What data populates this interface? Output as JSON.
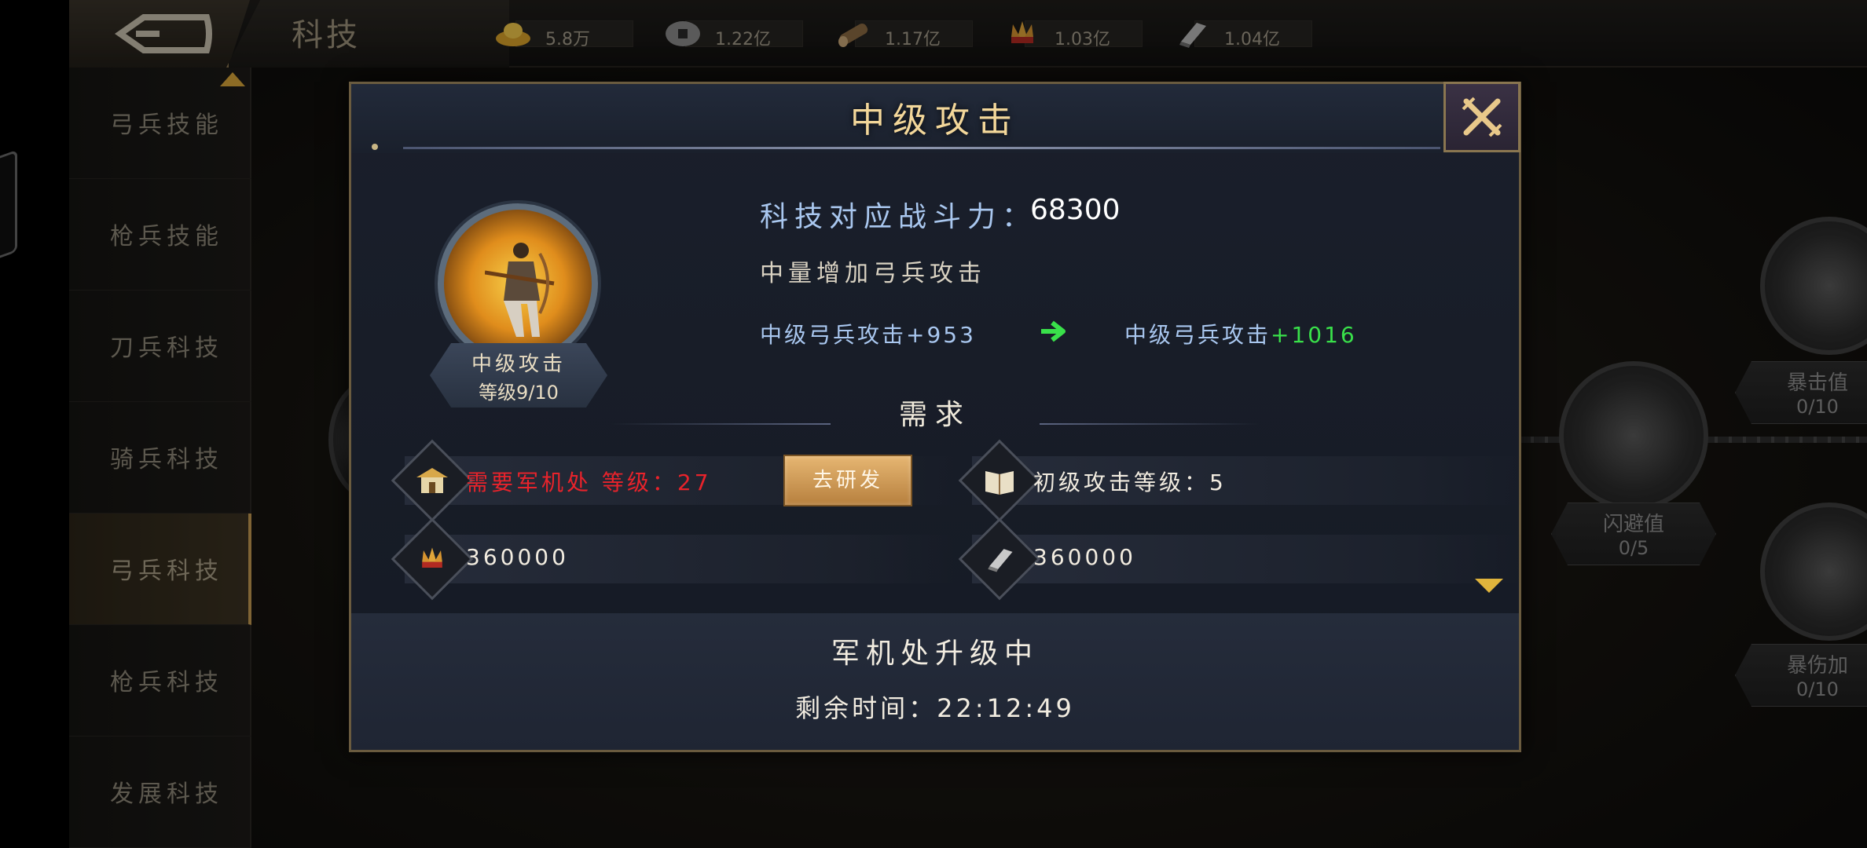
{
  "header": {
    "title": "科技",
    "resources": [
      {
        "icon": "gold-ingot-icon",
        "value": "5.8万"
      },
      {
        "icon": "coin-icon",
        "value": "1.22亿"
      },
      {
        "icon": "wood-icon",
        "value": "1.17亿"
      },
      {
        "icon": "grain-icon",
        "value": "1.03亿"
      },
      {
        "icon": "iron-icon",
        "value": "1.04亿"
      }
    ]
  },
  "sidebar": {
    "items": [
      {
        "label": "弓兵技能"
      },
      {
        "label": "枪兵技能"
      },
      {
        "label": "刀兵科技"
      },
      {
        "label": "骑兵科技"
      },
      {
        "label": "弓兵科技"
      },
      {
        "label": "枪兵科技"
      },
      {
        "label": "发展科技"
      }
    ],
    "active_index": 4
  },
  "background_nodes": [
    {
      "name": "暴击值",
      "level": "0/10"
    },
    {
      "name": "闪避值",
      "level": "0/5"
    },
    {
      "name": "暴伤加",
      "level": "0/10"
    }
  ],
  "modal": {
    "title": "中级攻击",
    "skill_name": "中级攻击",
    "skill_level": "等级9/10",
    "power_label": "科技对应战斗力：",
    "power_value": "68300",
    "description": "中量增加弓兵攻击",
    "stat_current": "中级弓兵攻击+953",
    "stat_next_label": "中级弓兵攻击",
    "stat_next_value": "+1016",
    "requirements_title": "需求",
    "requirements": {
      "building": "需要军机处 等级：27",
      "research_button": "去研发",
      "prerequisite": "初级攻击等级：5",
      "grain_cost": "360000",
      "iron_cost": "360000"
    },
    "footer_status": "军机处升级中",
    "footer_time": "剩余时间：22:12:49"
  },
  "colors": {
    "accent_gold": "#f3d79a",
    "stat_blue": "#a9c7ef",
    "increase_green": "#39e04a",
    "warning_red": "#e8232b"
  }
}
